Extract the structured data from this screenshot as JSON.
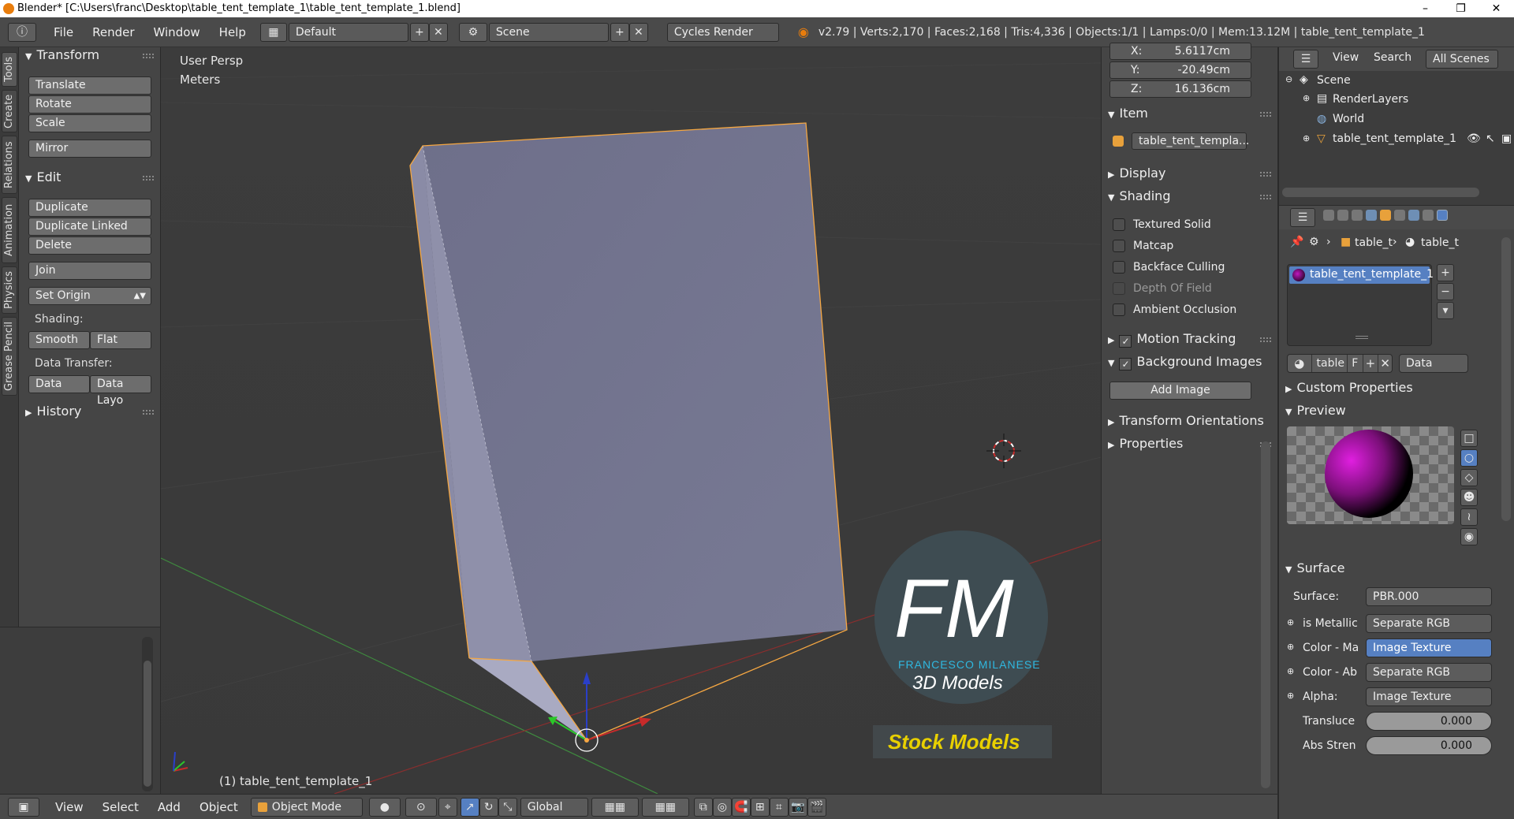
{
  "window": {
    "title": "Blender* [C:\\Users\\franc\\Desktop\\table_tent_template_1\\table_tent_template_1.blend]",
    "controls": [
      "–",
      "❐",
      "✕"
    ]
  },
  "info_bar": {
    "menus": [
      "File",
      "Render",
      "Window",
      "Help"
    ],
    "screen_layout": "Default",
    "scene": "Scene",
    "render_engine": "Cycles Render",
    "stats": "v2.79 | Verts:2,170 | Faces:2,168 | Tris:4,336 | Objects:1/1 | Lamps:0/0 | Mem:13.12M | table_tent_template_1"
  },
  "tool_tabs": [
    "Tools",
    "Create",
    "Relations",
    "Animation",
    "Physics",
    "Grease Pencil"
  ],
  "tool_shelf": {
    "transform_header": "Transform",
    "translate": "Translate",
    "rotate": "Rotate",
    "scale": "Scale",
    "mirror": "Mirror",
    "edit_header": "Edit",
    "duplicate": "Duplicate",
    "duplicate_linked": "Duplicate Linked",
    "delete": "Delete",
    "join": "Join",
    "set_origin": "Set Origin",
    "shading_label": "Shading:",
    "smooth": "Smooth",
    "flat": "Flat",
    "data_transfer_label": "Data Transfer:",
    "data": "Data",
    "data_layout": "Data Layo",
    "history_header": "History"
  },
  "viewport": {
    "view_name": "User Persp",
    "units": "Meters",
    "selected_object": "(1) table_tent_template_1",
    "watermark_letters": "FM",
    "watermark_name": "FRANCESCO MILANESE",
    "watermark_sub": "3D Models",
    "watermark_badge": "Stock Models"
  },
  "n_panel": {
    "x_label": "X:",
    "x_value": "5.6117cm",
    "y_label": "Y:",
    "y_value": "-20.49cm",
    "z_label": "Z:",
    "z_value": "16.136cm",
    "item_header": "Item",
    "item_name": "table_tent_templa...",
    "display_header": "Display",
    "shading_header": "Shading",
    "textured_solid": "Textured Solid",
    "matcap": "Matcap",
    "backface_culling": "Backface Culling",
    "depth_of_field": "Depth Of Field",
    "ambient_occlusion": "Ambient Occlusion",
    "motion_tracking": "Motion Tracking",
    "background_images": "Background Images",
    "add_image": "Add Image",
    "transform_orientations": "Transform Orientations",
    "properties": "Properties"
  },
  "outliner": {
    "view": "View",
    "search": "Search",
    "all_scenes": "All Scenes",
    "scene": "Scene",
    "render_layers": "RenderLayers",
    "world": "World",
    "object": "table_tent_template_1"
  },
  "properties": {
    "breadcrumb_1": "table_t",
    "breadcrumb_2": "table_t",
    "material_slot": "table_tent_template_1",
    "material_name": "table",
    "fake_user": "F",
    "data_link": "Data",
    "custom_properties": "Custom Properties",
    "preview": "Preview",
    "surface_header": "Surface",
    "surface_label": "Surface:",
    "surface_value": "PBR.000",
    "is_metallic_label": "is Metallic",
    "is_metallic_value": "Separate RGB",
    "color_ma_label": "Color - Ma",
    "color_ma_value": "Image Texture",
    "color_ab_label": "Color - Ab",
    "color_ab_value": "Separate RGB",
    "alpha_label": "Alpha:",
    "alpha_value": "Image Texture",
    "transluc_label": "Transluce",
    "transluc_value": "0.000",
    "abs_label": "Abs Stren",
    "abs_value": "0.000"
  },
  "bottom_bar": {
    "view": "View",
    "select": "Select",
    "add": "Add",
    "object": "Object",
    "mode": "Object Mode",
    "orientation": "Global"
  },
  "colors": {
    "accent_blue": "#5680c2",
    "selection_orange": "#f5a742",
    "mesh": "#8d8ea8",
    "watermark_cyan": "#2fb8e0",
    "watermark_yellow": "#e8d000"
  }
}
